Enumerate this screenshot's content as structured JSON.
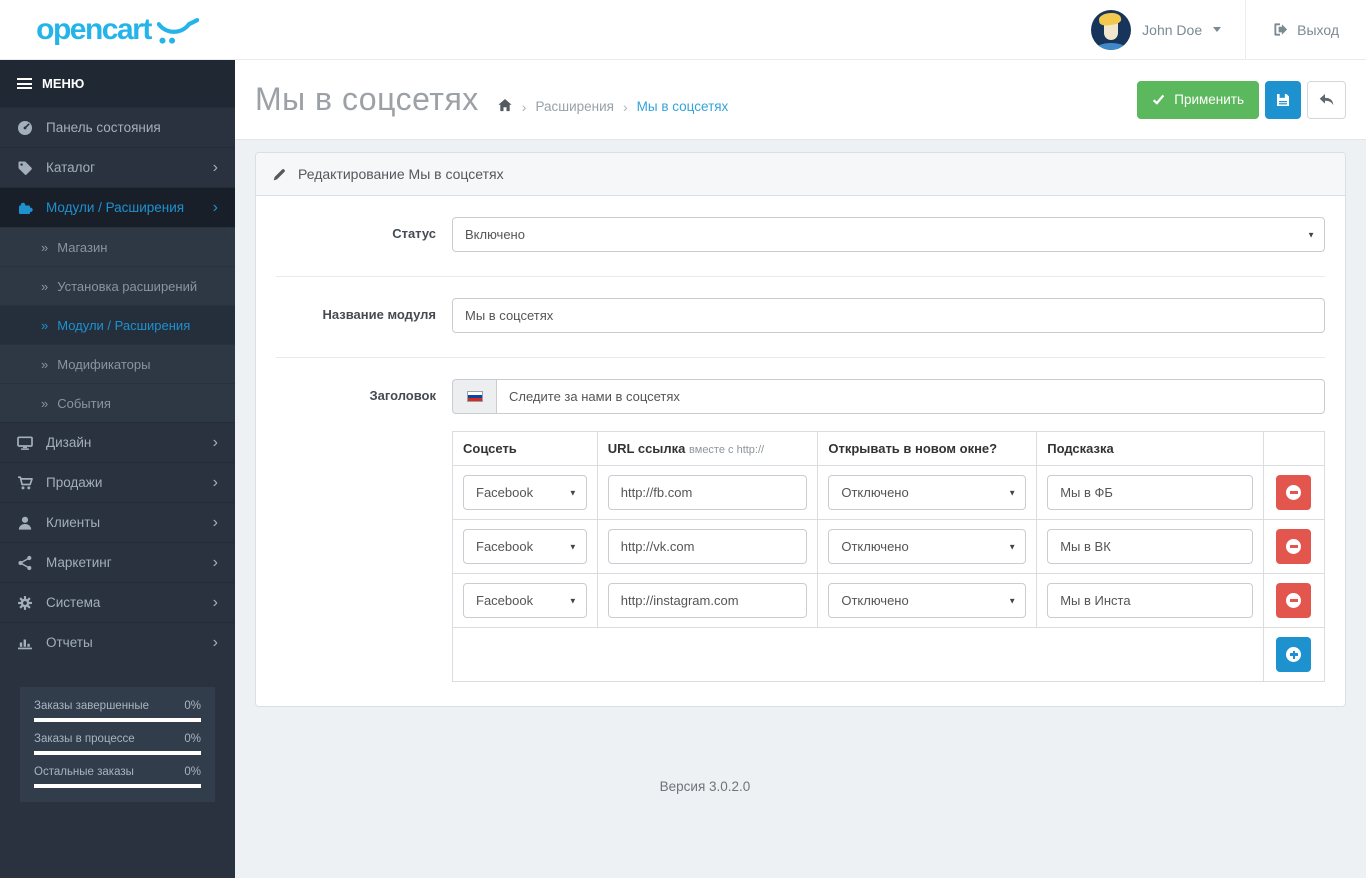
{
  "colors": {
    "accent-blue": "#1e91cf",
    "link-blue": "#33a3da",
    "green": "#5cb85c",
    "red": "#e2564d",
    "logo-cyan": "#25b4ea",
    "sidebar-bg": "#29323e",
    "sidebar-dark": "#1f2833",
    "sidebar-active": "#191f29",
    "submenu-bg": "#2e3845",
    "submenu-active": "#252f3b",
    "content-bg": "#eef1f4",
    "border": "#dcdfe2"
  },
  "header": {
    "logo_text": "opencart",
    "user_name": "John Doe",
    "logout_label": "Выход",
    "icons": {
      "user_caret": "caret-down-icon",
      "logout": "sign-out-icon",
      "cart": "cart-swoosh-icon"
    }
  },
  "sidebar": {
    "menu_title": "МЕНЮ",
    "items": [
      {
        "label": "Панель состояния",
        "icon": "dashboard-icon",
        "has_children": false,
        "active": false
      },
      {
        "label": "Каталог",
        "icon": "tag-icon",
        "has_children": true,
        "active": false
      },
      {
        "label": "Модули / Расширения",
        "icon": "puzzle-icon",
        "has_children": true,
        "active": true
      },
      {
        "label": "Дизайн",
        "icon": "monitor-icon",
        "has_children": true,
        "active": false
      },
      {
        "label": "Продажи",
        "icon": "cart-icon",
        "has_children": true,
        "active": false
      },
      {
        "label": "Клиенты",
        "icon": "user-icon",
        "has_children": true,
        "active": false
      },
      {
        "label": "Маркетинг",
        "icon": "share-icon",
        "has_children": true,
        "active": false
      },
      {
        "label": "Система",
        "icon": "gear-icon",
        "has_children": true,
        "active": false
      },
      {
        "label": "Отчеты",
        "icon": "bar-chart-icon",
        "has_children": true,
        "active": false
      }
    ],
    "submenu": [
      {
        "label": "Магазин",
        "active": false
      },
      {
        "label": "Установка расширений",
        "active": false
      },
      {
        "label": "Модули / Расширения",
        "active": true
      },
      {
        "label": "Модификаторы",
        "active": false
      },
      {
        "label": "События",
        "active": false
      }
    ],
    "stats": [
      {
        "label": "Заказы завершенные",
        "value": "0%"
      },
      {
        "label": "Заказы в процессе",
        "value": "0%"
      },
      {
        "label": "Остальные заказы",
        "value": "0%"
      }
    ]
  },
  "page": {
    "title": "Мы в соцсетях",
    "breadcrumb": {
      "home": "home-icon",
      "parent": "Расширения",
      "current": "Мы в соцсетях"
    },
    "apply_label": "Применить",
    "icons": {
      "apply": "check-icon",
      "save": "floppy-disk-icon",
      "back": "reply-arrow-icon"
    }
  },
  "panel": {
    "heading": "Редактирование Мы в соцсетях",
    "heading_icon": "pencil-icon",
    "form": {
      "status_label": "Статус",
      "status_value": "Включено",
      "module_name_label": "Название модуля",
      "module_name_value": "Мы в соцсетях",
      "heading_label": "Заголовок",
      "heading_flag": "russia-flag-icon",
      "heading_value": "Следите за нами в соцсетях"
    },
    "table": {
      "headers": [
        "Соцсеть",
        "URL ссылка",
        "Открывать в новом окне?",
        "Подсказка"
      ],
      "url_hint": "вместе с http://",
      "rows": [
        {
          "network": "Facebook",
          "url": "http://fb.com",
          "new_window": "Отключено",
          "tooltip": "Мы в ФБ"
        },
        {
          "network": "Facebook",
          "url": "http://vk.com",
          "new_window": "Отключено",
          "tooltip": "Мы в ВК"
        },
        {
          "network": "Facebook",
          "url": "http://instagram.com",
          "new_window": "Отключено",
          "tooltip": "Мы в Инста"
        }
      ],
      "remove_icon": "minus-circle-icon",
      "add_icon": "plus-circle-icon"
    }
  },
  "footer": {
    "version": "Версия 3.0.2.0"
  }
}
